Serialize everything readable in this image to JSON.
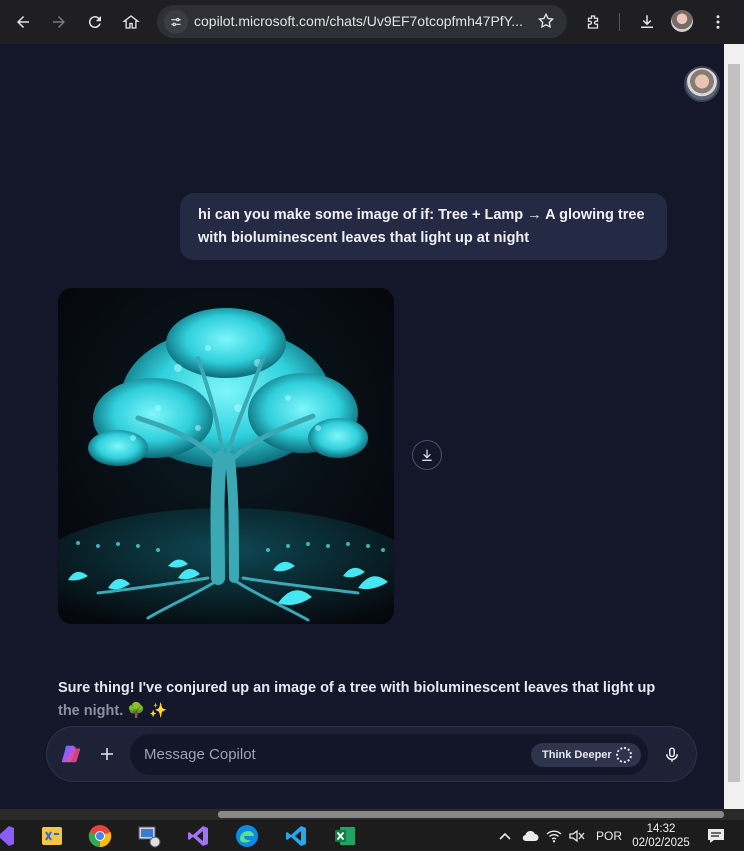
{
  "browser": {
    "url": "copilot.microsoft.com/chats/Uv9EF7otcopfmh47PfY..."
  },
  "chat": {
    "user_message": "hi can you make some image of if: Tree + Lamp → A glowing tree with bioluminescent leaves that light up at night",
    "generated_image_alt": "glowing-tree-image",
    "reply_line_1": "Sure thing! I've conjured up an image of a tree with bioluminescent leaves that light up",
    "reply_line_2": "the night. 🌳 ✨"
  },
  "composer": {
    "placeholder": "Message Copilot",
    "think_label": "Think Deeper"
  },
  "taskbar": {
    "language": "POR",
    "time": "14:32",
    "date": "02/02/2025"
  },
  "colors": {
    "page_bg": "#131729",
    "bubble_bg": "#242a44",
    "glow": "#3ee6f0"
  }
}
